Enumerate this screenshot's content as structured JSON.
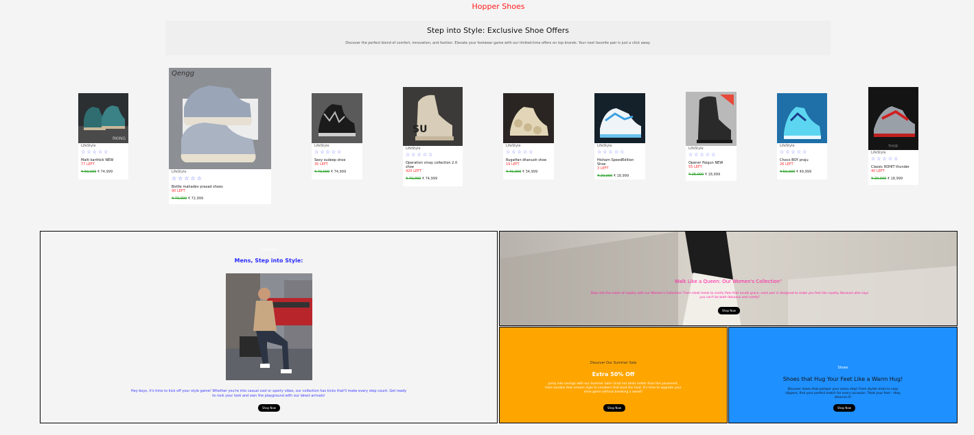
{
  "site": {
    "title": "Hopper Shoes"
  },
  "hero": {
    "title": "Step into Style: Exclusive Shoe Offers",
    "subtitle": "Discover the perfect blend of comfort, innovation, and fashion. Elevate your footwear game with our limited-time offers on top brands. Your next favorite pair is just a click away."
  },
  "products": [
    {
      "category": "LifeStyle",
      "name": "Malti karthick NEW",
      "left": "77 LEFT",
      "old_price": "₹ 60,000",
      "price": "₹ 74,999",
      "stars": "☆☆☆☆☆"
    },
    {
      "category": "LifeStyle",
      "name": "Bottle mahadev prasad shoes",
      "left": "90 LEFT",
      "old_price": "₹ 70,000",
      "price": "₹ 72,999",
      "stars": "☆☆☆☆☆",
      "brand_mark": "Qengg"
    },
    {
      "category": "LifeStyle",
      "name": "Sexy sudeep shoe",
      "left": "35 LEFT",
      "old_price": "₹ 70,000",
      "price": "₹ 74,999",
      "stars": "☆☆☆☆☆"
    },
    {
      "category": "LifeStyle",
      "name": "Operation vinay collection 2.0 shoe",
      "left": "420 LEFT",
      "old_price": "₹ 70,000",
      "price": "₹ 74,999",
      "stars": "☆☆☆☆☆"
    },
    {
      "category": "LifeStyle",
      "name": "Rugatfan dhanush shoe",
      "left": "19 LEFT",
      "old_price": "₹ 45,000",
      "price": "₹ 34,999",
      "stars": "☆☆☆☆☆"
    },
    {
      "category": "LifeStyle",
      "name": "Hisham SpeedEdition Shoe",
      "left": "3 LEFT",
      "old_price": "₹ 20,000",
      "price": "₹ 18,999",
      "stars": "☆☆☆☆☆"
    },
    {
      "category": "LifeStyle",
      "name": "Opener Paigun NEW",
      "left": "55 LEFT",
      "old_price": "₹ 25,000",
      "price": "₹ 18,999",
      "stars": "☆☆☆☆☆"
    },
    {
      "category": "LifeStyle",
      "name": "Choco BOY praju",
      "left": "26 LEFT",
      "old_price": "₹ 50,000",
      "price": "₹ 49,999",
      "stars": "☆☆☆☆☆"
    },
    {
      "category": "LifeStyle",
      "name": "Classic ROHIT thunder",
      "left": "40 LEFT",
      "old_price": "₹ 20,000",
      "price": "₹ 18,999",
      "stars": "☆☆☆☆☆",
      "brand_mark": "THOR"
    }
  ],
  "men": {
    "kicker": "Collection",
    "title": "Mens, Step into Style:",
    "description": "Hey boys, it's time to kick off your style game! Whether you're into casual cool or sporty vibes, our collection has kicks that'll make every step count. Get ready to rock your look and own the playground with our latest arrivals!",
    "button": "Shop Now"
  },
  "women": {
    "title": "Walk Like a Queen: Our Women's Collection\"",
    "description": "Step into the realm of royalty with our Women's Collection! From sleek heels to comfy flats that exude grace, each pair is designed to make you feel like royalty. Because who says you can't be both fabulous and comfy?",
    "button": "Shop Now"
  },
  "summer": {
    "kicker": "Discover Our Summer Sale",
    "title": "Extra 50% Off",
    "description": "Jump into savings with our Summer Sale! Grab hot deals hotter than the pavement, from sandals that scream style to sneakers that beat the heat. It's time to upgrade your shoe game without breaking a sweat!",
    "button": "Shop Now"
  },
  "hug": {
    "kicker": "Shoes",
    "title": "Shoes that Hug Your Feet Like a Warm Hug!",
    "description": "Discover shoes that pamper your every step! From stylish kicks to cozy slippers, find your perfect match for every occasion. Treat your feet – they deserve it!",
    "button": "Shop Now"
  },
  "colors": {
    "accent_red": "#ff1a1a",
    "star_blue": "#4b5cff",
    "summer_orange": "#ffa500",
    "hug_blue": "#1e90ff",
    "women_pink": "#ff1aa3"
  }
}
